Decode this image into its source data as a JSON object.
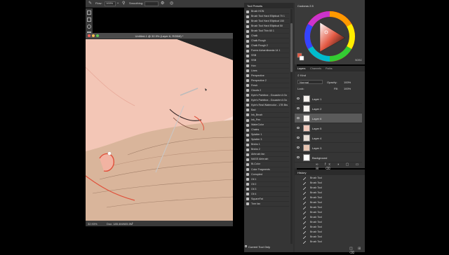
{
  "options_bar": {
    "flow_label": "Flow:",
    "flow_value": "100%",
    "smoothing_label": "Smoothing:"
  },
  "document": {
    "title": "Untitled-1 @ 32.9% (Layer 6, RGB/8) *",
    "zoom": "32.93%",
    "doc_size": "Doc: 185.4M/605.5M"
  },
  "tool_presets": {
    "tab_label": "Tool Presets",
    "items": [
      "Brush HON",
      "Brush Tool Hard Elliptical 70 1",
      "Brush Tool Hard Elliptical 150",
      "Brush Tool Hard Elliptical 50",
      "Brush Tool Thin 60 1",
      "Chalk",
      "Chalk Rough",
      "Chalk Rough 2",
      "Forme Acharnibonda 14 1",
      "SSB",
      "SSB",
      "Hon",
      "Lines",
      "Perspective",
      "Perspective 2",
      "Fresh",
      "Clouds 2",
      "Kyle's Paintbox - Gouache A Go",
      "Kyle's Paintbox - Gouache A Go",
      "Kyle's Real Watercolor - 17B Bru",
      "Bad",
      "Ink_Brush",
      "Ink_Pen",
      "WaterColor",
      "Chains",
      "Splatter 1",
      "Splatter 3",
      "Bricks 1",
      "Bricks 2",
      "Airbrush fan",
      "MASS Airbrush",
      "Bi-Color",
      "Color Fragments",
      "Corrupted",
      "Oil 1",
      "Oil 2",
      "Oil 3",
      "Oil 4",
      "SquareFat",
      "Tree fan"
    ],
    "current_tool_only": "Current Tool Only"
  },
  "color_panel": {
    "title": "Coolorus 2.5",
    "mode": "SOSC"
  },
  "layers_panel": {
    "tabs": [
      "Layers",
      "Channels",
      "Paths"
    ],
    "kind": "Kind",
    "blend_mode": "Normal",
    "opacity_label": "Opacity:",
    "opacity_value": "100%",
    "lock_label": "Lock:",
    "fill_label": "Fill:",
    "fill_value": "100%",
    "layers": [
      "Layer 1",
      "Layer 2",
      "Layer 6",
      "Layer 5",
      "Layer 4",
      "Layer 3",
      "Background"
    ],
    "selected_index": 2
  },
  "history_panel": {
    "tab_label": "History",
    "items": [
      "Brush Tool",
      "Brush Tool",
      "Brush Tool",
      "Brush Tool",
      "Brush Tool",
      "Brush Tool",
      "Brush Tool",
      "Brush Tool",
      "Brush Tool",
      "Brush Tool",
      "Brush Tool",
      "Brush Tool",
      "Brush Tool",
      "Brush Tool"
    ]
  },
  "colors": {
    "ui_dark": "#353535",
    "canvas_bg": "#f7d9cf",
    "canvas_skin": "#f5cabc",
    "hair": "#d9b59b",
    "accent_red": "#e0503a"
  }
}
